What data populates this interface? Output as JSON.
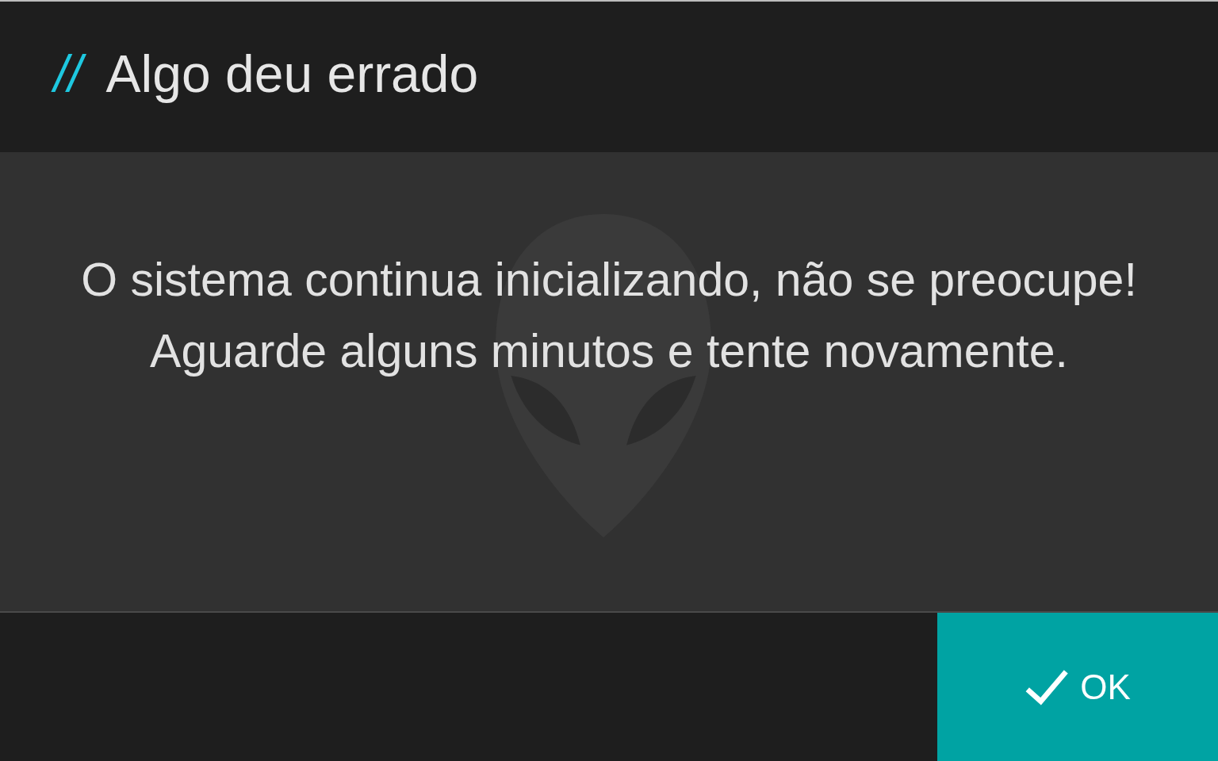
{
  "dialog": {
    "title_mark": "//",
    "title": "Algo deu errado",
    "message": [
      "O sistema continua inicializando, não se preocupe!",
      "Aguarde alguns minutos e tente novamente."
    ],
    "buttons": [
      {
        "kind": "confirm",
        "label": "OK"
      }
    ]
  }
}
